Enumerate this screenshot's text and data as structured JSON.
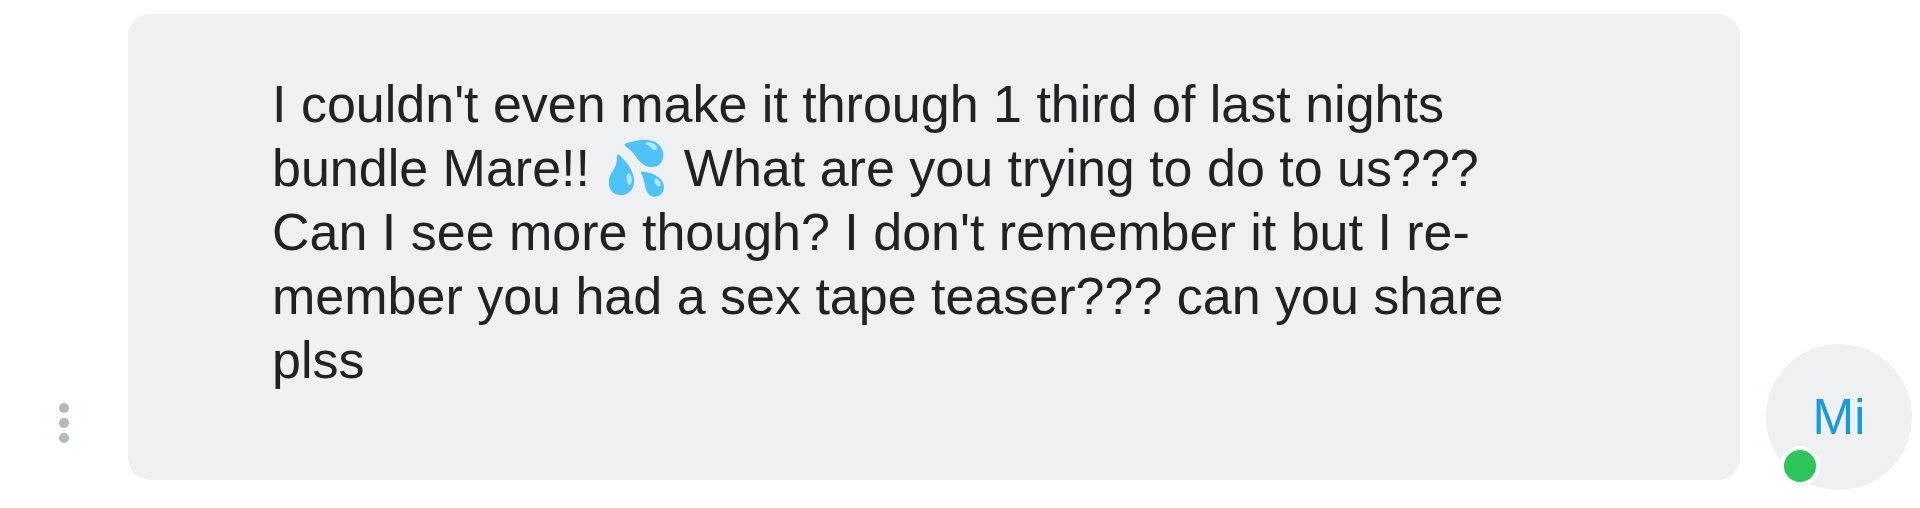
{
  "message": {
    "lines": [
      "I couldn't even make it through 1 third of last nights",
      "bundle Mare!! 💦 What are you trying to do to us???",
      "Can I see more though? I don't remember it but I re-",
      "member you had a sex tape teaser??? can you share",
      "plss"
    ]
  },
  "avatar": {
    "initials": "Mi",
    "online": true
  }
}
